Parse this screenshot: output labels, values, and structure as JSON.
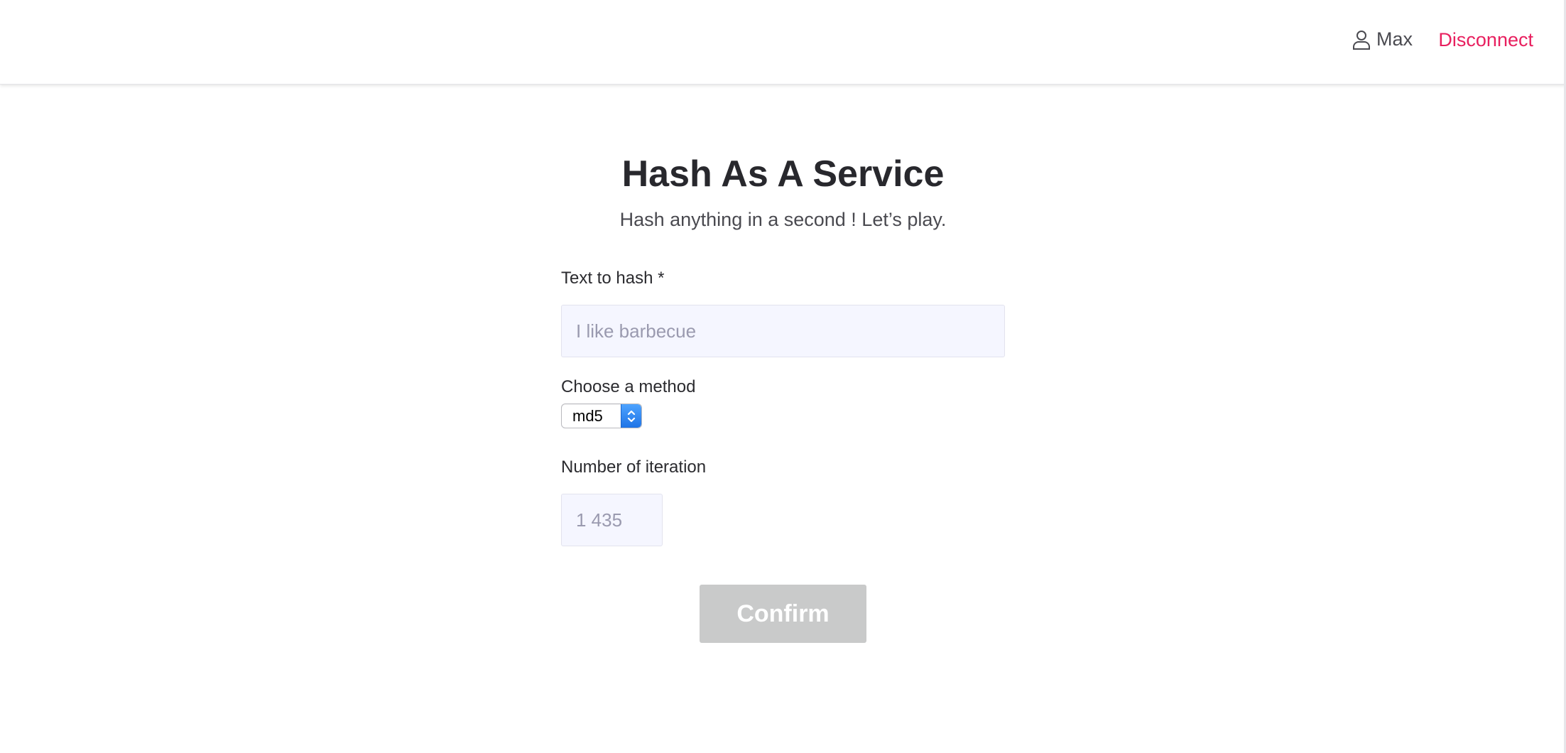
{
  "header": {
    "username": "Max",
    "disconnect_label": "Disconnect",
    "user_icon": "user-icon",
    "disconnect_color": "#e8205f"
  },
  "main": {
    "title": "Hash As A Service",
    "subtitle": "Hash anything in a second ! Let’s play."
  },
  "form": {
    "text_label": "Text to hash *",
    "text_value": "",
    "text_placeholder": "I like barbecue",
    "method_label": "Choose a method",
    "method_selected": "md5",
    "iteration_label": "Number of iteration",
    "iteration_value": "",
    "iteration_placeholder": "1 435",
    "confirm_label": "Confirm",
    "confirm_color": "#c9caca"
  }
}
